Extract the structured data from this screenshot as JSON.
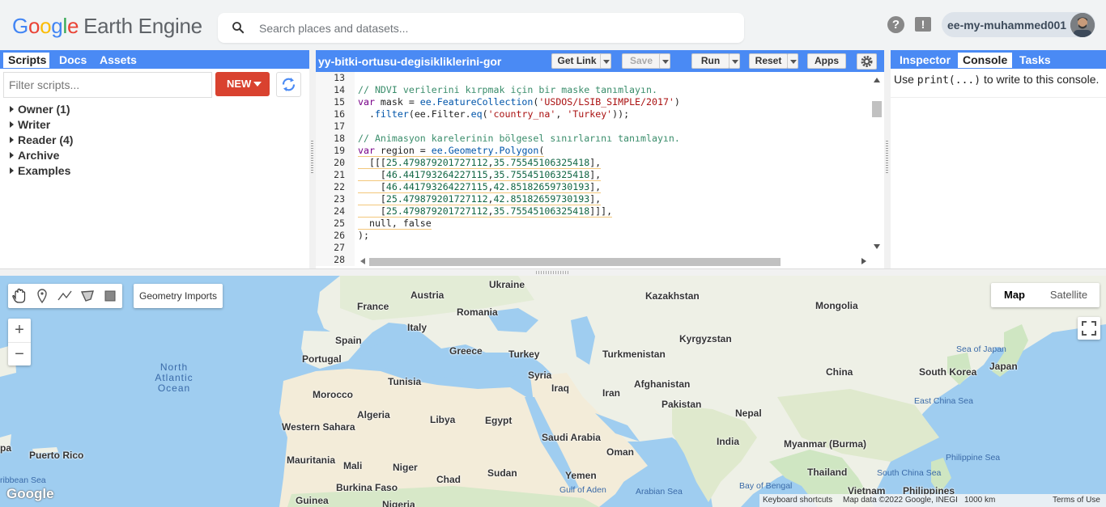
{
  "header": {
    "logo_google": [
      "G",
      "o",
      "o",
      "g",
      "l",
      "e"
    ],
    "logo_product": "Earth Engine",
    "search_placeholder": "Search places and datasets...",
    "help_glyph": "?",
    "feedback_glyph": "!",
    "account_name": "ee-my-muhammed001"
  },
  "left_panel": {
    "tabs": [
      {
        "label": "Scripts",
        "active": true
      },
      {
        "label": "Docs",
        "active": false
      },
      {
        "label": "Assets",
        "active": false
      }
    ],
    "filter_placeholder": "Filter scripts...",
    "new_button": "NEW",
    "tree": [
      "Owner (1)",
      "Writer",
      "Reader (4)",
      "Archive",
      "Examples"
    ]
  },
  "editor": {
    "script_title": "yy-bitki-ortusu-degisikliklerini-gor",
    "buttons": {
      "get_link": "Get Link",
      "save": "Save",
      "run": "Run",
      "reset": "Reset",
      "apps": "Apps"
    },
    "line_numbers": [
      "13",
      "14",
      "15",
      "16",
      "17",
      "18",
      "19",
      "20",
      "21",
      "22",
      "23",
      "24",
      "25",
      "26",
      "27",
      "28"
    ],
    "code_lines": [
      [],
      [
        {
          "t": "cm",
          "v": "// NDVI verilerini kırpmak için bir maske tanımlayın."
        }
      ],
      [
        {
          "t": "kw",
          "v": "var"
        },
        {
          "t": "def",
          "v": " mask = "
        },
        {
          "t": "fn",
          "v": "ee.FeatureCollection"
        },
        {
          "t": "def",
          "v": "("
        },
        {
          "t": "str",
          "v": "'USDOS/LSIB_SIMPLE/2017'"
        },
        {
          "t": "def",
          "v": ")"
        }
      ],
      [
        {
          "t": "def",
          "v": "  ."
        },
        {
          "t": "fn",
          "v": "filter"
        },
        {
          "t": "def",
          "v": "(ee.Filter."
        },
        {
          "t": "fn",
          "v": "eq"
        },
        {
          "t": "def",
          "v": "("
        },
        {
          "t": "str",
          "v": "'country_na'"
        },
        {
          "t": "def",
          "v": ", "
        },
        {
          "t": "str",
          "v": "'Turkey'"
        },
        {
          "t": "def",
          "v": "));"
        }
      ],
      [],
      [
        {
          "t": "cm",
          "v": "// Animasyon karelerinin bölgesel sınırlarını tanımlayın."
        }
      ],
      [
        {
          "t": "kw",
          "v": "var"
        },
        {
          "t": "def",
          "v": " region = "
        },
        {
          "t": "fn",
          "v": "ee.Geometry.Polygon"
        },
        {
          "t": "def",
          "v": "("
        }
      ],
      [
        {
          "t": "def",
          "v": "  [[["
        },
        {
          "t": "num",
          "v": "25.479879201727112"
        },
        {
          "t": "def",
          "v": ","
        },
        {
          "t": "num",
          "v": "35.75545106325418"
        },
        {
          "t": "def",
          "v": "],"
        }
      ],
      [
        {
          "t": "def",
          "v": "    ["
        },
        {
          "t": "num",
          "v": "46.441793264227115"
        },
        {
          "t": "def",
          "v": ","
        },
        {
          "t": "num",
          "v": "35.75545106325418"
        },
        {
          "t": "def",
          "v": "],"
        }
      ],
      [
        {
          "t": "def",
          "v": "    ["
        },
        {
          "t": "num",
          "v": "46.441793264227115"
        },
        {
          "t": "def",
          "v": ","
        },
        {
          "t": "num",
          "v": "42.85182659730193"
        },
        {
          "t": "def",
          "v": "],"
        }
      ],
      [
        {
          "t": "def",
          "v": "    ["
        },
        {
          "t": "num",
          "v": "25.479879201727112"
        },
        {
          "t": "def",
          "v": ","
        },
        {
          "t": "num",
          "v": "42.85182659730193"
        },
        {
          "t": "def",
          "v": "],"
        }
      ],
      [
        {
          "t": "def",
          "v": "    ["
        },
        {
          "t": "num",
          "v": "25.479879201727112"
        },
        {
          "t": "def",
          "v": ","
        },
        {
          "t": "num",
          "v": "35.75545106325418"
        },
        {
          "t": "def",
          "v": "]]],"
        }
      ],
      [
        {
          "t": "def",
          "v": "  null, false"
        }
      ],
      [
        {
          "t": "def",
          "v": ");"
        }
      ],
      [],
      []
    ]
  },
  "right_panel": {
    "tabs": [
      {
        "label": "Inspector",
        "active": false
      },
      {
        "label": "Console",
        "active": true
      },
      {
        "label": "Tasks",
        "active": false
      }
    ],
    "console_prefix": "Use ",
    "console_code": "print(...)",
    "console_suffix": " to write to this console."
  },
  "map": {
    "geometry_imports": "Geometry Imports",
    "zoom_in": "+",
    "zoom_out": "−",
    "map_type": "Map",
    "satellite_type": "Satellite",
    "google_logo": "Google",
    "keyboard_shortcuts": "Keyboard shortcuts",
    "map_data": "Map data ©2022 Google, INEGI",
    "scale": "1000 km",
    "terms": "Terms of Use",
    "labels": [
      {
        "text": "Ukraine",
        "cls": "country"
      },
      {
        "text": "Kazakhstan",
        "cls": "country"
      },
      {
        "text": "Mongolia",
        "cls": "country"
      },
      {
        "text": "Austria",
        "cls": "country"
      },
      {
        "text": "France",
        "cls": "country"
      },
      {
        "text": "Romania",
        "cls": "country"
      },
      {
        "text": "Italy",
        "cls": "country"
      },
      {
        "text": "Kyrgyzstan",
        "cls": "country"
      },
      {
        "text": "Spain",
        "cls": "country"
      },
      {
        "text": "Greece",
        "cls": "country"
      },
      {
        "text": "Portugal",
        "cls": "country"
      },
      {
        "text": "Turkey",
        "cls": "country"
      },
      {
        "text": "Turkmenistan",
        "cls": "country"
      },
      {
        "text": "Syria",
        "cls": "country"
      },
      {
        "text": "Tunisia",
        "cls": "country"
      },
      {
        "text": "Afghanistan",
        "cls": "country"
      },
      {
        "text": "China",
        "cls": "country"
      },
      {
        "text": "South Korea",
        "cls": "country"
      },
      {
        "text": "Japan",
        "cls": "country"
      },
      {
        "text": "Iraq",
        "cls": "country"
      },
      {
        "text": "Iran",
        "cls": "country"
      },
      {
        "text": "Morocco",
        "cls": "country"
      },
      {
        "text": "Pakistan",
        "cls": "country"
      },
      {
        "text": "Algeria",
        "cls": "country"
      },
      {
        "text": "Libya",
        "cls": "country"
      },
      {
        "text": "Egypt",
        "cls": "country"
      },
      {
        "text": "Nepal",
        "cls": "country"
      },
      {
        "text": "Western Sahara",
        "cls": "country"
      },
      {
        "text": "Saudi Arabia",
        "cls": "country"
      },
      {
        "text": "India",
        "cls": "country"
      },
      {
        "text": "Myanmar (Burma)",
        "cls": "country"
      },
      {
        "text": "Puerto Rico",
        "cls": "country"
      },
      {
        "text": "Mauritania",
        "cls": "country"
      },
      {
        "text": "Mali",
        "cls": "country"
      },
      {
        "text": "Niger",
        "cls": "country"
      },
      {
        "text": "Oman",
        "cls": "country"
      },
      {
        "text": "Sudan",
        "cls": "country"
      },
      {
        "text": "Chad",
        "cls": "country"
      },
      {
        "text": "Yemen",
        "cls": "country"
      },
      {
        "text": "Thailand",
        "cls": "country"
      },
      {
        "text": "Burkina Faso",
        "cls": "country"
      },
      {
        "text": "Guinea",
        "cls": "country"
      },
      {
        "text": "Nigeria",
        "cls": "country"
      },
      {
        "text": "Vietnam",
        "cls": "country"
      },
      {
        "text": "Philippines",
        "cls": "country"
      },
      {
        "text": "pa",
        "cls": "country"
      },
      {
        "text": "North Atlantic Ocean",
        "cls": "ocean"
      },
      {
        "text": "Sea of Japan",
        "cls": "sea"
      },
      {
        "text": "East China Sea",
        "cls": "sea"
      },
      {
        "text": "Philippine Sea",
        "cls": "sea"
      },
      {
        "text": "South China Sea",
        "cls": "sea"
      },
      {
        "text": "Bay of Bengal",
        "cls": "sea"
      },
      {
        "text": "Arabian Sea",
        "cls": "sea"
      },
      {
        "text": "Gulf of Aden",
        "cls": "sea"
      },
      {
        "text": "ribbean Sea",
        "cls": "sea"
      }
    ]
  },
  "colors": {
    "accent": "#4a8af4",
    "new_button": "#d9422f",
    "water": "#9fcdf0",
    "land": "#eef0e6",
    "vegetation": "#cfe6c2",
    "desert": "#f3ecd9"
  }
}
